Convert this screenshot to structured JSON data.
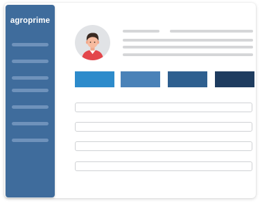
{
  "app": {
    "logo_text": "agroprime"
  },
  "sidebar": {
    "nav_items": [
      {
        "name": "sidebar-item-1"
      },
      {
        "name": "sidebar-item-2"
      },
      {
        "name": "sidebar-item-3"
      },
      {
        "name": "sidebar-item-4"
      },
      {
        "name": "sidebar-item-5"
      },
      {
        "name": "sidebar-item-6"
      },
      {
        "name": "sidebar-item-7"
      }
    ]
  },
  "profile": {
    "avatar_icon": "user-avatar-icon"
  },
  "action_tiles": [
    {
      "name": "action-tile-1",
      "color": "#2d8bcb"
    },
    {
      "name": "action-tile-2",
      "color": "#4a82b8"
    },
    {
      "name": "action-tile-3",
      "color": "#2e5f8f"
    },
    {
      "name": "action-tile-4",
      "color": "#1e3c5f"
    }
  ],
  "colors": {
    "sidebar": "#3f6c9c",
    "sidebar_item": "#6f92bb",
    "placeholder_line": "#d5d6d8",
    "field_border": "#cfd1d4"
  }
}
